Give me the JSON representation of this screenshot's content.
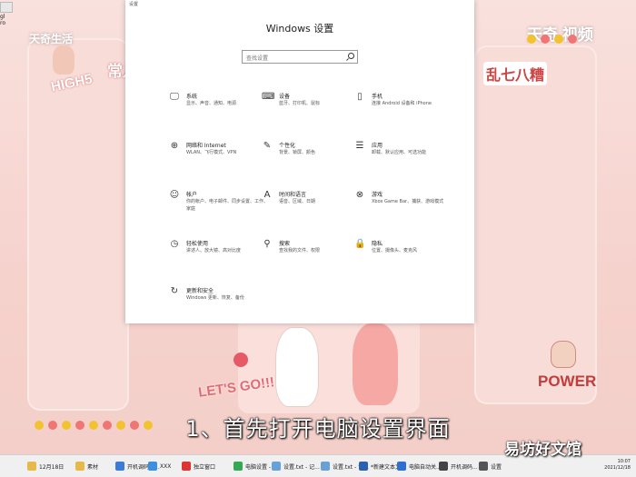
{
  "wallpaper": {
    "watermark_left": "天奇生活",
    "watermark_right": "天奇 视频",
    "left_panel_text": "常儿",
    "high5": "HIGH5",
    "right_panel_text": "乱七八糟",
    "lets_go": "LET'S GO!!!",
    "power": "POWER",
    "desktop_icon_labels": [
      "gl",
      "ro"
    ]
  },
  "settings": {
    "window_title": "设置",
    "heading": "Windows 设置",
    "search_placeholder": "查找设置",
    "categories": [
      {
        "icon": "monitor-icon",
        "glyph": "🖵",
        "name": "系统",
        "desc": "显示、声音、通知、电源"
      },
      {
        "icon": "devices-icon",
        "glyph": "⌨",
        "name": "设备",
        "desc": "蓝牙、打印机、鼠标"
      },
      {
        "icon": "phone-icon",
        "glyph": "▯",
        "name": "手机",
        "desc": "连接 Android 设备和 iPhone"
      },
      {
        "icon": "globe-icon",
        "glyph": "⊕",
        "name": "网络和 Internet",
        "desc": "WLAN、飞行模式、VPN"
      },
      {
        "icon": "brush-icon",
        "glyph": "✎",
        "name": "个性化",
        "desc": "背景、锁屏、颜色"
      },
      {
        "icon": "apps-icon",
        "glyph": "☰",
        "name": "应用",
        "desc": "卸载、默认应用、可选功能"
      },
      {
        "icon": "person-icon",
        "glyph": "☺",
        "name": "帐户",
        "desc": "你的帐户、电子邮件、同步设置、工作、家庭"
      },
      {
        "icon": "time-language-icon",
        "glyph": "A",
        "name": "时间和语言",
        "desc": "语音、区域、日期"
      },
      {
        "icon": "xbox-icon",
        "glyph": "⊗",
        "name": "游戏",
        "desc": "Xbox Game Bar、捕获、游戏模式"
      },
      {
        "icon": "ease-of-access-icon",
        "glyph": "◷",
        "name": "轻松使用",
        "desc": "讲述人、放大镜、高对比度"
      },
      {
        "icon": "search-icon",
        "glyph": "⚲",
        "name": "搜索",
        "desc": "查找我的文件、权限"
      },
      {
        "icon": "lock-icon",
        "glyph": "🔒",
        "name": "隐私",
        "desc": "位置、摄像头、麦克风"
      },
      {
        "icon": "update-icon",
        "glyph": "↻",
        "name": "更新和安全",
        "desc": "Windows 更新、恢复、备份"
      }
    ]
  },
  "subtitle": "1、首先打开电脑设置界面",
  "corner_logo": "易坊好文馆",
  "taskbar": {
    "items": [
      {
        "icon": "folder-icon",
        "color": "#e6b94a",
        "label": "12月18日"
      },
      {
        "icon": "folder-icon",
        "color": "#e6b94a",
        "label": "素材"
      },
      {
        "icon": "app-icon",
        "color": "#3c7bd6",
        "label": "开机调码告..."
      },
      {
        "icon": "app-icon",
        "color": "#3b8fe0",
        "label": "XXX"
      },
      {
        "icon": "app-icon",
        "color": "#d33",
        "label": "独立窗口"
      },
      {
        "icon": "chrome-icon",
        "color": "#34a853",
        "label": "电脑设置 - ..."
      },
      {
        "icon": "notepad-icon",
        "color": "#6aa0d8",
        "label": "设置.txt - 记..."
      },
      {
        "icon": "notepad-icon",
        "color": "#6aa0d8",
        "label": "设置.txt - 记..."
      },
      {
        "icon": "word-icon",
        "color": "#2b5fb4",
        "label": "*新建文本文..."
      },
      {
        "icon": "app-icon",
        "color": "#2f6fd0",
        "label": "电脑自动关..."
      },
      {
        "icon": "app-icon",
        "color": "#444",
        "label": "开机调码..."
      },
      {
        "icon": "gear-icon",
        "color": "#555",
        "label": "设置"
      }
    ],
    "clock_time": "10:07",
    "clock_date": "2021/12/18"
  }
}
